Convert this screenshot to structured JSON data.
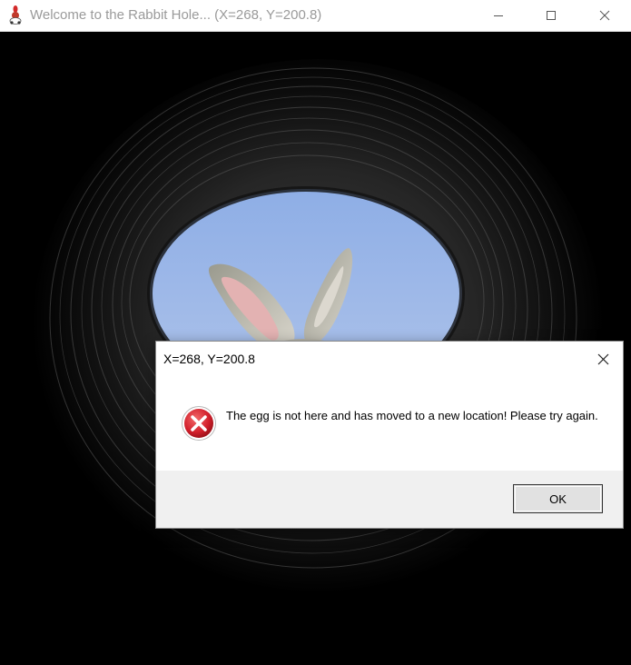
{
  "window": {
    "title": "Welcome to the Rabbit Hole... (X=268, Y=200.8)",
    "app_icon": "rabbit-app-icon",
    "controls": [
      "minimize-icon",
      "maximize-icon",
      "close-icon"
    ]
  },
  "scene": {
    "description_icon": "rabbit-hole-image",
    "sky_color": "#9ab3e3",
    "tunnel_color": "#000000"
  },
  "dialog": {
    "title": "X=268, Y=200.8",
    "icon": "error-icon",
    "message": "The egg is not here and has moved to a new location! Please try again.",
    "ok_label": "OK",
    "error_color": "#d21f2b"
  }
}
